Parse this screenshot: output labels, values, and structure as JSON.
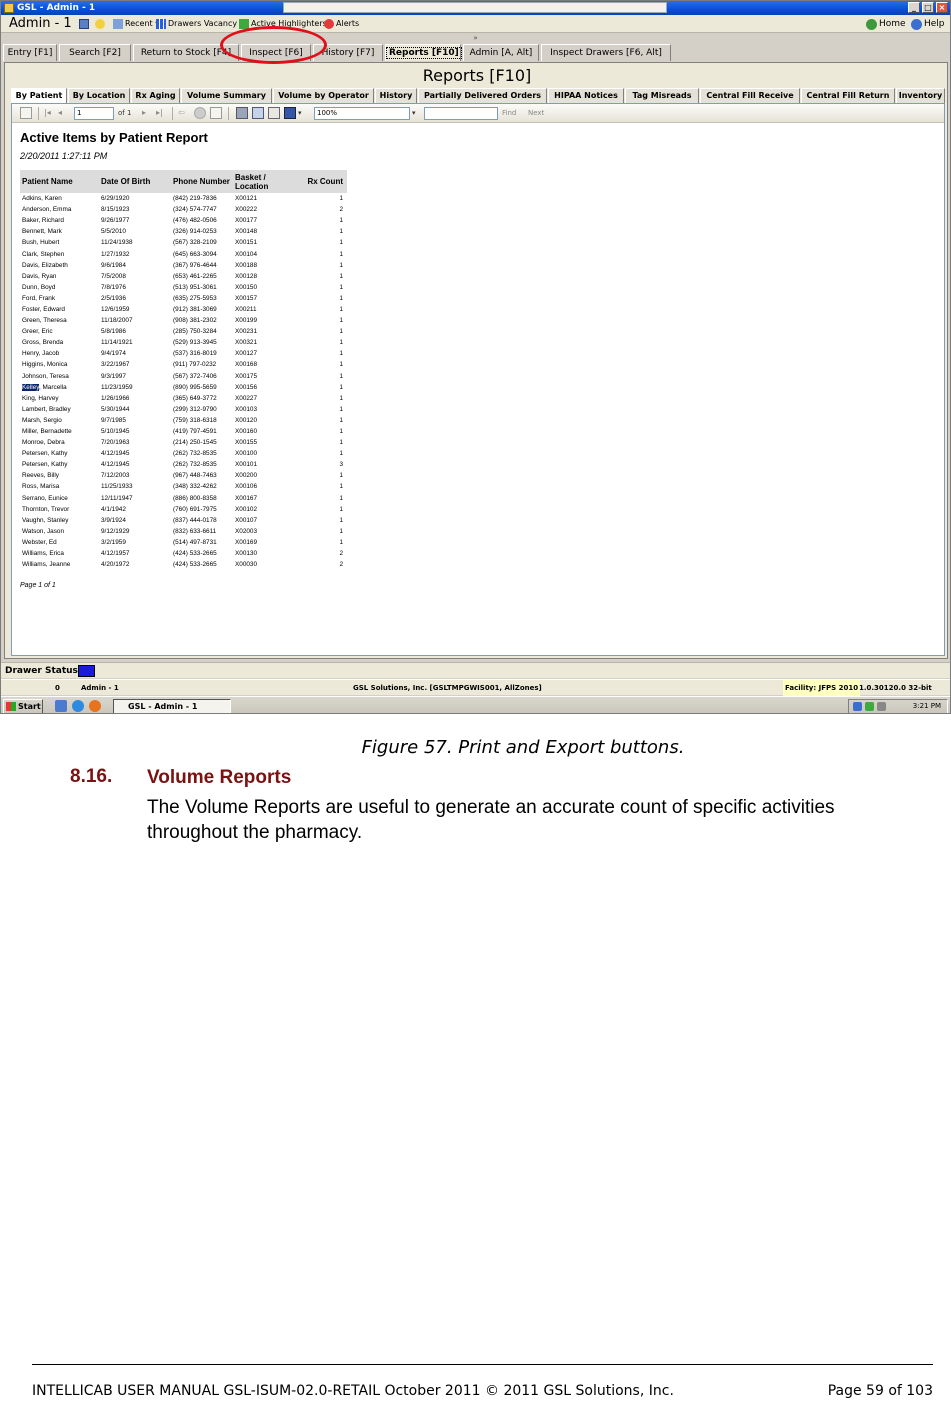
{
  "window": {
    "title": "GSL - Admin - 1",
    "minimize": "_",
    "maximize": "□",
    "close": "×"
  },
  "toolbar": {
    "user": "Admin - 1",
    "recent": "Recent ▾",
    "drawers_vacancy": "Drawers Vacancy",
    "active_highlighters": "Active Highlighters",
    "alerts": "Alerts",
    "home": "Home",
    "help": "Help"
  },
  "collapse_glyph": "»",
  "main_tabs": [
    {
      "label": "Entry [F1]"
    },
    {
      "label": "Search [F2]"
    },
    {
      "label": "Return to Stock [F4]"
    },
    {
      "label": "Inspect [F6]"
    },
    {
      "label": "History [F7]"
    },
    {
      "label": "Reports [F10]"
    },
    {
      "label": "Admin [A, Alt]"
    },
    {
      "label": "Inspect Drawers [F6, Alt]"
    }
  ],
  "page_heading": "Reports [F10]",
  "sub_tabs": [
    {
      "label": "By Patient"
    },
    {
      "label": "By Location"
    },
    {
      "label": "Rx Aging"
    },
    {
      "label": "Volume Summary"
    },
    {
      "label": "Volume by Operator"
    },
    {
      "label": "History"
    },
    {
      "label": "Partially Delivered Orders"
    },
    {
      "label": "HIPAA Notices"
    },
    {
      "label": "Tag Misreads"
    },
    {
      "label": "Central Fill Receive"
    },
    {
      "label": "Central Fill Return"
    },
    {
      "label": "Inventory"
    }
  ],
  "viewer": {
    "page_value": "1",
    "page_of": "of 1",
    "zoom": "100%",
    "find": "Find",
    "next": "Next"
  },
  "report": {
    "title": "Active Items by Patient Report",
    "date": "2/20/2011 1:27:11 PM",
    "headers": [
      "Patient Name",
      "Date Of Birth",
      "Phone Number",
      "Basket / Location",
      "Rx Count"
    ],
    "rows": [
      [
        "Adkins, Karen",
        "6/29/1920",
        "(842) 219-7836",
        "X00121",
        "1"
      ],
      [
        "Anderson, Emma",
        "8/15/1923",
        "(324) 574-7747",
        "X00222",
        "2"
      ],
      [
        "Baker, Richard",
        "9/26/1977",
        "(476) 482-0506",
        "X00177",
        "1"
      ],
      [
        "Bennett, Mark",
        "5/5/2010",
        "(326) 914-0253",
        "X00148",
        "1"
      ],
      [
        "Bush, Hubert",
        "11/24/1938",
        "(567) 328-2109",
        "X00151",
        "1"
      ],
      [
        "Clark, Stephen",
        "1/27/1932",
        "(645) 663-3094",
        "X00104",
        "1"
      ],
      [
        "Davis, Elizabeth",
        "9/6/1984",
        "(367) 976-4644",
        "X00188",
        "1"
      ],
      [
        "Davis, Ryan",
        "7/5/2008",
        "(653) 461-2265",
        "X00128",
        "1"
      ],
      [
        "Dunn, Boyd",
        "7/8/1976",
        "(513) 951-3061",
        "X00150",
        "1"
      ],
      [
        "Ford, Frank",
        "2/5/1936",
        "(635) 275-5953",
        "X00157",
        "1"
      ],
      [
        "Foster, Edward",
        "12/6/1959",
        "(912) 381-3069",
        "X00211",
        "1"
      ],
      [
        "Green, Theresa",
        "11/18/2007",
        "(908) 381-2302",
        "X00199",
        "1"
      ],
      [
        "Greer, Eric",
        "5/8/1986",
        "(285) 750-3284",
        "X00231",
        "1"
      ],
      [
        "Gross, Brenda",
        "11/14/1921",
        "(529) 913-3945",
        "X00321",
        "1"
      ],
      [
        "Henry, Jacob",
        "9/4/1974",
        "(537) 316-8019",
        "X00127",
        "1"
      ],
      [
        "Higgins, Monica",
        "3/22/1967",
        "(911) 797-0232",
        "X00168",
        "1"
      ],
      [
        "Johnson, Teresa",
        "9/3/1997",
        "(567) 372-7406",
        "X00175",
        "1"
      ],
      [
        "Kelley, Marcella",
        "11/23/1959",
        "(890) 995-5659",
        "X00156",
        "1"
      ],
      [
        "King, Harvey",
        "1/26/1966",
        "(365) 649-3772",
        "X00227",
        "1"
      ],
      [
        "Lambert, Bradley",
        "5/30/1944",
        "(299) 312-9790",
        "X00103",
        "1"
      ],
      [
        "Marsh, Sergio",
        "9/7/1985",
        "(759) 318-6318",
        "X00120",
        "1"
      ],
      [
        "Miller, Bernadette",
        "5/10/1945",
        "(419) 797-4591",
        "X00160",
        "1"
      ],
      [
        "Monroe, Debra",
        "7/20/1963",
        "(214) 250-1545",
        "X00155",
        "1"
      ],
      [
        "Petersen, Kathy",
        "4/12/1945",
        "(262) 732-8535",
        "X00100",
        "1"
      ],
      [
        "Petersen, Kathy",
        "4/12/1945",
        "(262) 732-8535",
        "X00101",
        "3"
      ],
      [
        "Reeves, Billy",
        "7/12/2003",
        "(967) 448-7463",
        "X00200",
        "1"
      ],
      [
        "Ross, Marisa",
        "11/25/1933",
        "(348) 332-4262",
        "X00106",
        "1"
      ],
      [
        "Serrano, Eunice",
        "12/11/1947",
        "(886) 800-8358",
        "X00167",
        "1"
      ],
      [
        "Thornton, Trevor",
        "4/1/1942",
        "(760) 691-7975",
        "X00102",
        "1"
      ],
      [
        "Vaughn, Stanley",
        "3/9/1924",
        "(837) 444-0178",
        "X00107",
        "1"
      ],
      [
        "Watson, Jason",
        "9/12/1929",
        "(832) 633-6611",
        "X02003",
        "1"
      ],
      [
        "Webster, Ed",
        "3/2/1959",
        "(514) 497-8731",
        "X00169",
        "1"
      ],
      [
        "Williams, Erica",
        "4/12/1957",
        "(424) 533-2665",
        "X00130",
        "2"
      ],
      [
        "Williams, Jeanne",
        "4/20/1972",
        "(424) 533-2665",
        "X00030",
        "2"
      ]
    ],
    "selected_word": "Kelley",
    "selected_rest": ", Marcella",
    "footer": "Page 1 of 1"
  },
  "drawer_status": "Drawer Status:",
  "status_bar": {
    "count": "0",
    "user": "Admin - 1",
    "company": "GSL Solutions, Inc. [GSLTMPGWIS001, AllZones]",
    "facility": "Facility: JFPS 2010",
    "version": "1.0.30120.0 32-bit"
  },
  "taskbar": {
    "start": "Start",
    "task": "GSL - Admin - 1",
    "clock": "3:21 PM"
  },
  "document": {
    "caption": "Figure 57. Print and Export buttons.",
    "section_number": "8.16.",
    "section_title": "Volume Reports",
    "section_body": "The Volume Reports are useful to generate an accurate count of specific activities throughout the pharmacy.",
    "footer_left": "INTELLICAB USER MANUAL GSL-ISUM-02.0-RETAIL October 2011 © 2011 GSL Solutions, Inc.",
    "footer_right": "Page 59 of 103"
  },
  "colors": {
    "section_heading": "#7a1212",
    "highlight_oval": "#e0101a",
    "drawer_indicator": "#1a1adc"
  }
}
